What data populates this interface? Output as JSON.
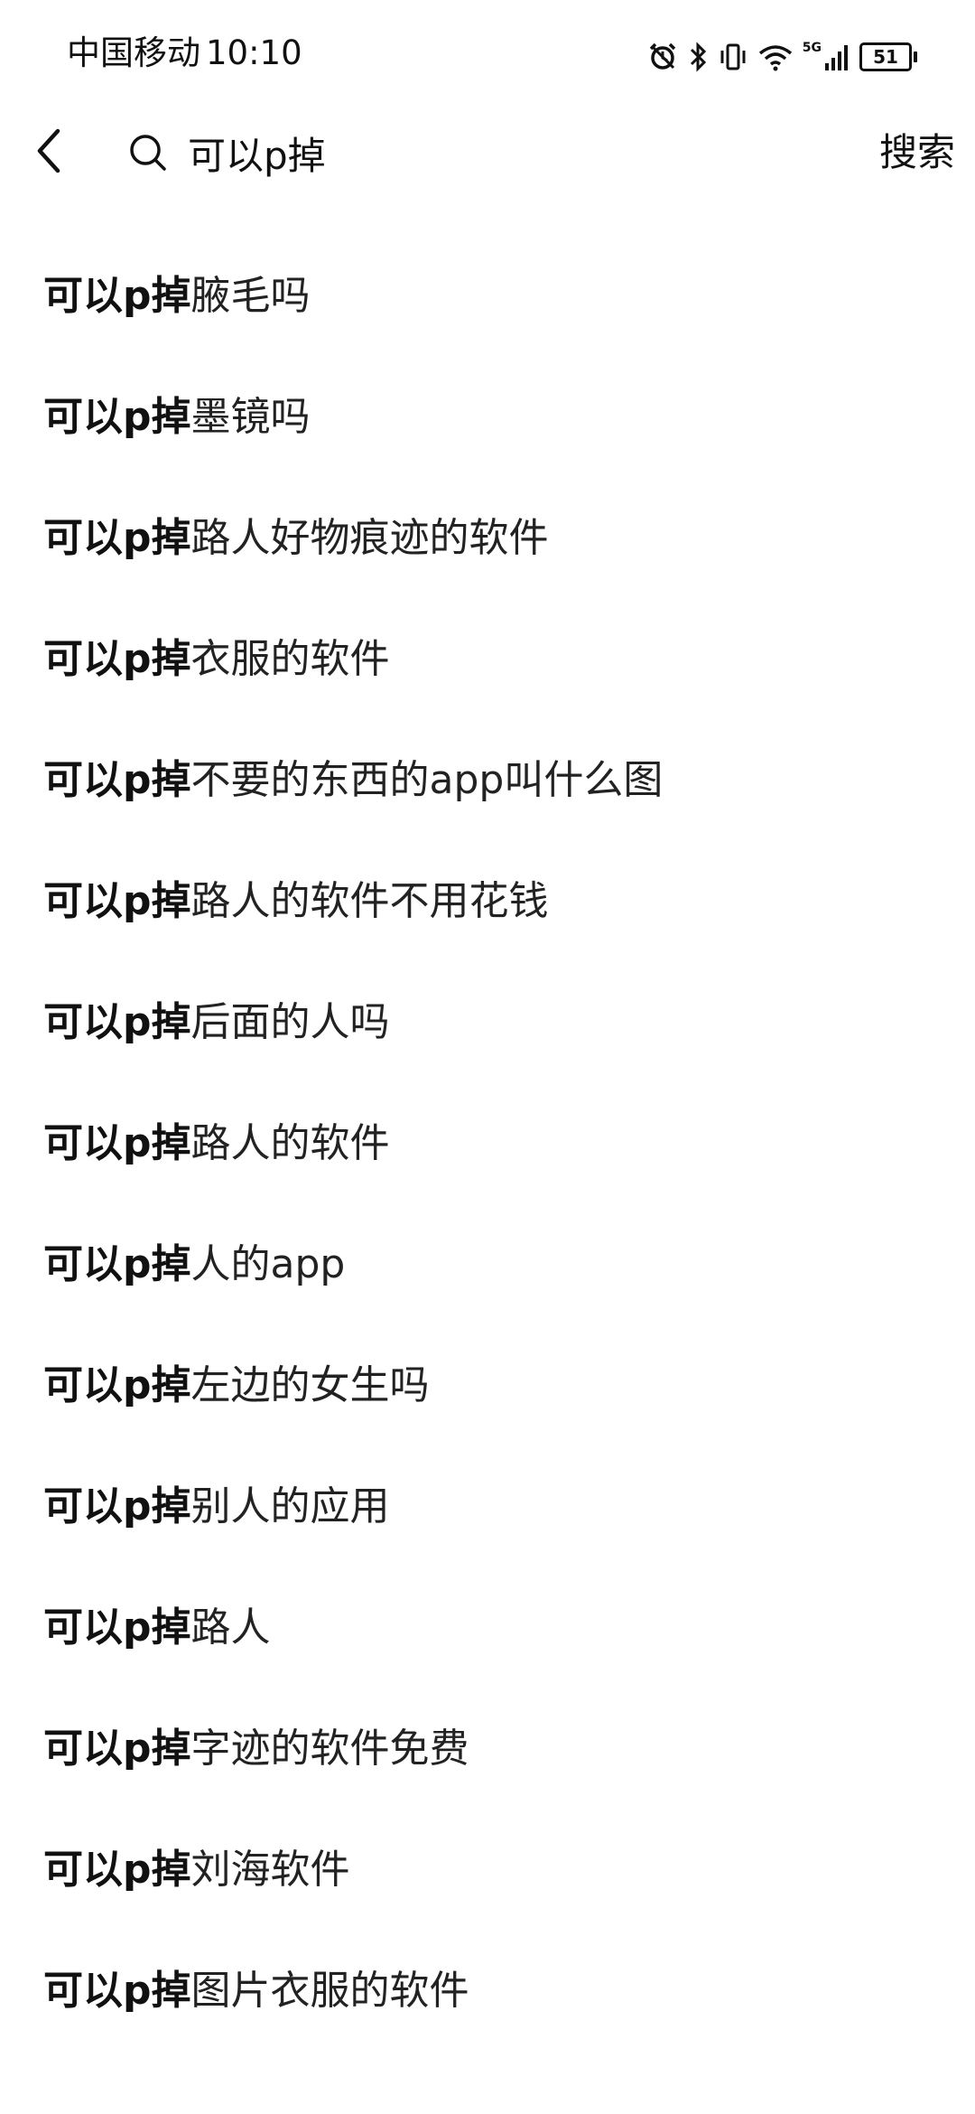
{
  "status_bar": {
    "carrier": "中国移动",
    "time": "10:10",
    "network_label": "5G",
    "battery": "51",
    "icons": [
      "alarm-icon",
      "bluetooth-icon",
      "vibrate-icon",
      "wifi-icon",
      "signal-icon",
      "battery-icon"
    ]
  },
  "search": {
    "query": "可以p掉",
    "button_label": "搜索",
    "back_icon": "chevron-left-icon",
    "search_icon": "search-icon"
  },
  "suggestions": [
    {
      "highlight": "可以p掉",
      "rest": "腋毛吗"
    },
    {
      "highlight": "可以p掉",
      "rest": "墨镜吗"
    },
    {
      "highlight": "可以p掉",
      "rest": "路人好物痕迹的软件"
    },
    {
      "highlight": "可以p掉",
      "rest": "衣服的软件"
    },
    {
      "highlight": "可以p掉",
      "rest": "不要的东西的app叫什么图"
    },
    {
      "highlight": "可以p掉",
      "rest": "路人的软件不用花钱"
    },
    {
      "highlight": "可以p掉",
      "rest": "后面的人吗"
    },
    {
      "highlight": "可以p掉",
      "rest": "路人的软件"
    },
    {
      "highlight": "可以p掉",
      "rest": "人的app"
    },
    {
      "highlight": "可以p掉",
      "rest": "左边的女生吗"
    },
    {
      "highlight": "可以p掉",
      "rest": "别人的应用"
    },
    {
      "highlight": "可以p掉",
      "rest": "路人"
    },
    {
      "highlight": "可以p掉",
      "rest": "字迹的软件免费"
    },
    {
      "highlight": "可以p掉",
      "rest": "刘海软件"
    },
    {
      "highlight": "可以p掉",
      "rest": "图片衣服的软件"
    }
  ]
}
